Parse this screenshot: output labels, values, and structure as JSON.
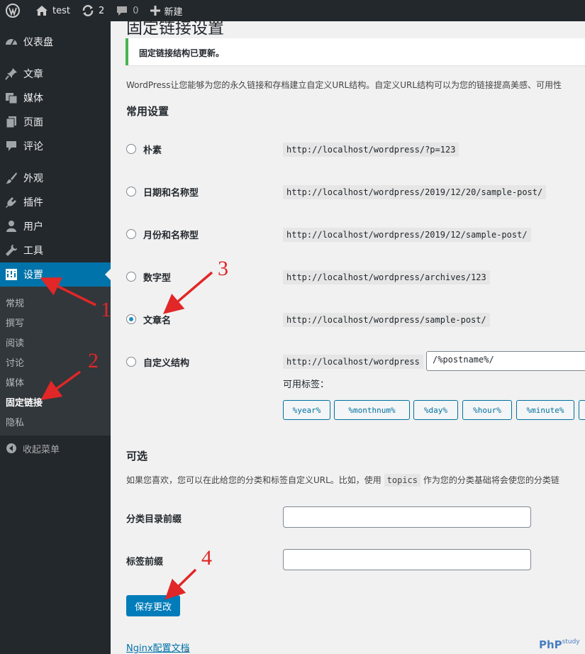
{
  "adminbar": {
    "site": "test",
    "updates": "2",
    "comments": "0",
    "new": "新建"
  },
  "sidebar": {
    "items": [
      {
        "label": "仪表盘",
        "icon": "dashboard-icon"
      },
      {
        "label": "文章",
        "icon": "pin-icon"
      },
      {
        "label": "媒体",
        "icon": "media-icon"
      },
      {
        "label": "页面",
        "icon": "page-icon"
      },
      {
        "label": "评论",
        "icon": "comment-icon"
      },
      {
        "label": "外观",
        "icon": "brush-icon"
      },
      {
        "label": "插件",
        "icon": "plugin-icon"
      },
      {
        "label": "用户",
        "icon": "user-icon"
      },
      {
        "label": "工具",
        "icon": "wrench-icon"
      },
      {
        "label": "设置",
        "icon": "settings-icon"
      }
    ],
    "submenu": [
      "常规",
      "撰写",
      "阅读",
      "讨论",
      "媒体",
      "固定链接",
      "隐私"
    ],
    "collapse": "收起菜单"
  },
  "main": {
    "title": "固定链接设置",
    "notice": "固定链接结构已更新。",
    "intro": "WordPress让您能够为您的永久链接和存档建立自定义URL结构。自定义URL结构可以为您的链接提高美感、可用性",
    "common_heading": "常用设置",
    "options": [
      {
        "label": "朴素",
        "url": "http://localhost/wordpress/?p=123",
        "checked": false
      },
      {
        "label": "日期和名称型",
        "url": "http://localhost/wordpress/2019/12/20/sample-post/",
        "checked": false
      },
      {
        "label": "月份和名称型",
        "url": "http://localhost/wordpress/2019/12/sample-post/",
        "checked": false
      },
      {
        "label": "数字型",
        "url": "http://localhost/wordpress/archives/123",
        "checked": false
      },
      {
        "label": "文章名",
        "url": "http://localhost/wordpress/sample-post/",
        "checked": true
      },
      {
        "label": "自定义结构",
        "url": "http://localhost/wordpress",
        "checked": false
      }
    ],
    "custom_value": "/%postname%/",
    "available_tags_label": "可用标签：",
    "tags": [
      "%year%",
      "%monthnum%",
      "%day%",
      "%hour%",
      "%minute%"
    ],
    "optional_heading": "可选",
    "optional_text_1": "如果您喜欢，您可以在此给您的分类和标签自定义URL。比如，使用",
    "optional_code": "topics",
    "optional_text_2": "作为您的分类基础将会使您的分类链",
    "category_base_label": "分类目录前缀",
    "tag_base_label": "标签前缀",
    "save_label": "保存更改",
    "nginx_link": "Nginx配置文档",
    "nginx_tail": "。"
  },
  "annotations": [
    "1",
    "2",
    "3",
    "4"
  ],
  "logo": {
    "text": "PhP",
    "small": "study"
  },
  "colors": {
    "accent": "#0073aa",
    "sidebar": "#23282d",
    "annotation": "#e12727",
    "notice": "#46b450"
  }
}
